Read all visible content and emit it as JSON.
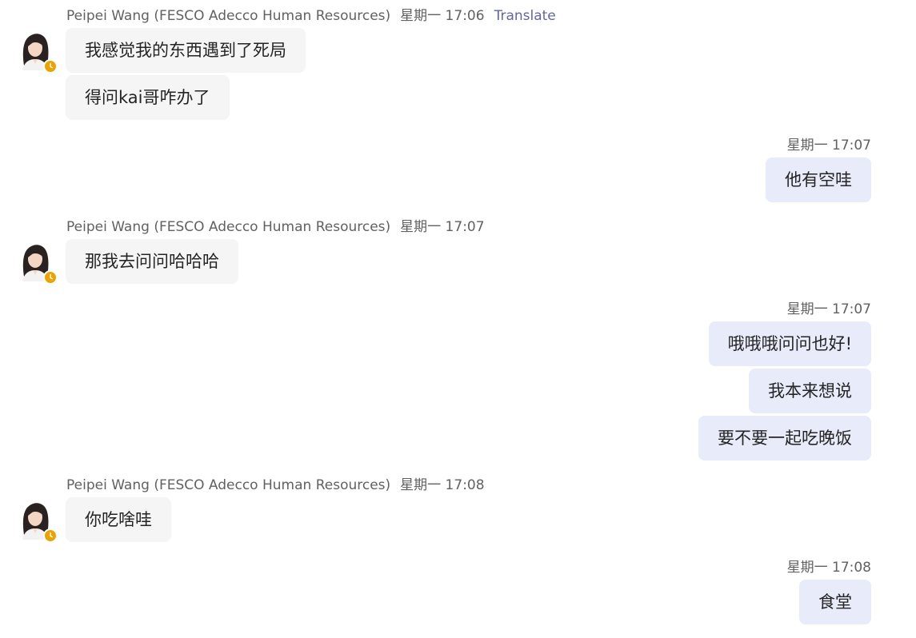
{
  "groups": [
    {
      "side": "in",
      "sender": "Peipei Wang (FESCO Adecco Human Resources)",
      "time": "星期一 17:06",
      "translate": "Translate",
      "messages": [
        "我感觉我的东西遇到了死局",
        "得问kai哥咋办了"
      ]
    },
    {
      "side": "out",
      "time": "星期一 17:07",
      "messages": [
        "他有空哇"
      ]
    },
    {
      "side": "in",
      "sender": "Peipei Wang (FESCO Adecco Human Resources)",
      "time": "星期一 17:07",
      "messages": [
        "那我去问问哈哈哈"
      ]
    },
    {
      "side": "out",
      "time": "星期一 17:07",
      "messages": [
        "哦哦哦问问也好!",
        "我本来想说",
        "要不要一起吃晚饭"
      ]
    },
    {
      "side": "in",
      "sender": "Peipei Wang (FESCO Adecco Human Resources)",
      "time": "星期一 17:08",
      "messages": [
        "你吃啥哇"
      ]
    },
    {
      "side": "out",
      "time": "星期一 17:08",
      "messages": [
        "食堂"
      ]
    }
  ],
  "avatar": {
    "icon": "person-avatar-icon",
    "status_icon": "away-clock-icon",
    "status_color": "#eaa300"
  },
  "colors": {
    "incoming_bubble": "#f5f5f5",
    "outgoing_bubble": "#e8ebfa",
    "translate_link": "#6264a7",
    "meta_text": "#616161"
  }
}
